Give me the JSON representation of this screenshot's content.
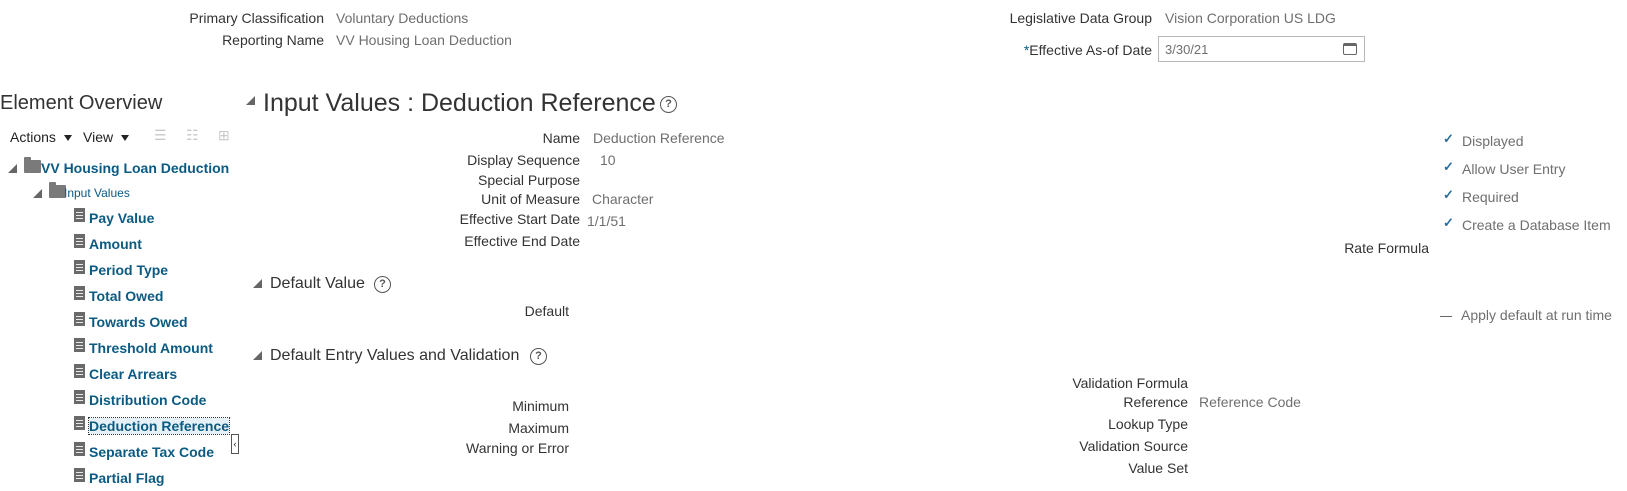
{
  "header": {
    "primary_classification_label": "Primary Classification",
    "primary_classification_value": "Voluntary Deductions",
    "reporting_name_label": "Reporting Name",
    "reporting_name_value": "VV Housing Loan Deduction",
    "ldg_label": "Legislative Data Group",
    "ldg_value": "Vision Corporation US LDG",
    "effective_date_required": "*",
    "effective_date_label": "Effective As-of Date",
    "effective_date_value": "3/30/21"
  },
  "sidebar": {
    "title": "Element Overview",
    "actions_label": "Actions",
    "view_label": "View",
    "root_label": "VV Housing Loan Deduction",
    "folder_label": "Input Values",
    "items": [
      {
        "label": "Pay Value"
      },
      {
        "label": "Amount"
      },
      {
        "label": "Period Type"
      },
      {
        "label": "Total Owed"
      },
      {
        "label": "Towards Owed"
      },
      {
        "label": "Threshold Amount"
      },
      {
        "label": "Clear Arrears"
      },
      {
        "label": "Distribution Code"
      },
      {
        "label": "Deduction Reference",
        "selected": true
      },
      {
        "label": "Separate Tax Code"
      },
      {
        "label": "Partial Flag"
      }
    ]
  },
  "main": {
    "title": "Input Values : Deduction Reference",
    "fields": {
      "name_label": "Name",
      "name_value": "Deduction Reference",
      "display_sequence_label": "Display Sequence",
      "display_sequence_value": "10",
      "special_purpose_label": "Special Purpose",
      "unit_of_measure_label": "Unit of Measure",
      "unit_of_measure_value": "Character",
      "effective_start_label": "Effective Start Date",
      "effective_start_value": "1/1/51",
      "effective_end_label": "Effective End Date",
      "rate_formula_label": "Rate Formula"
    },
    "flags": [
      {
        "label": "Displayed",
        "checked": true
      },
      {
        "label": "Allow User Entry",
        "checked": true
      },
      {
        "label": "Required",
        "checked": true
      },
      {
        "label": "Create a Database Item",
        "checked": true
      }
    ],
    "default_value": {
      "title": "Default Value",
      "default_label": "Default",
      "apply_default_label": "Apply default at run time",
      "apply_default_checked": false
    },
    "validation": {
      "title": "Default Entry Values and Validation",
      "validation_formula_label": "Validation Formula",
      "reference_label": "Reference",
      "reference_value": "Reference Code",
      "minimum_label": "Minimum",
      "maximum_label": "Maximum",
      "lookup_type_label": "Lookup Type",
      "warning_label": "Warning or Error",
      "validation_source_label": "Validation Source",
      "value_set_label": "Value Set"
    }
  },
  "colors": {
    "link": "#0b5a82",
    "value_text": "#6f6f6f",
    "check": "#2a6f9c"
  }
}
